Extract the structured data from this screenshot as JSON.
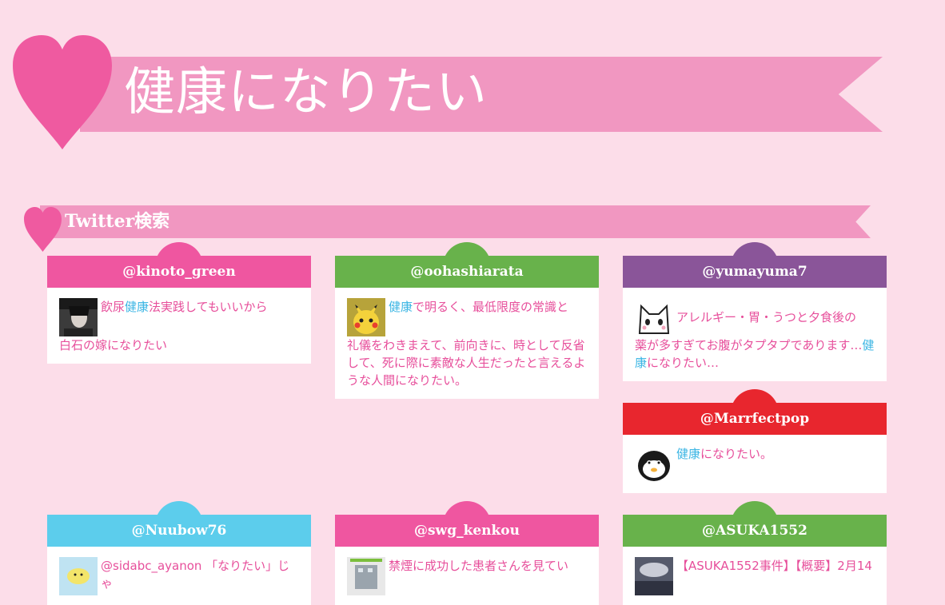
{
  "page": {
    "title": "健康になりたい"
  },
  "section": {
    "title": "Twitter検索"
  },
  "colors": {
    "background": "#fcdde9",
    "banner": "#f197c1",
    "heart": "#ef5aa0",
    "pink": "#ef56a0",
    "green": "#68b24b",
    "purple": "#8a5599",
    "red": "#e8262e",
    "blue": "#5ccdec",
    "highlight": "#3db6e4",
    "text": "#e74f9b"
  },
  "tweets": [
    {
      "user": "@kinoto_green",
      "color": "pink",
      "avatar": "dark-portrait",
      "pre": "飲尿",
      "hl": "健康",
      "post": "法実践してもいいから",
      "cont": "白石の嫁になりたい"
    },
    {
      "user": "@oohashiarata",
      "color": "green",
      "avatar": "pikachu",
      "pre": "",
      "hl": "健康",
      "post": "で明るく、最低限度の常識と",
      "cont": "礼儀をわきまえて、前向きに、時として反省して、死に際に素敵な人生だったと言えるような人間になりたい。"
    },
    {
      "user": "@yumayuma7",
      "color": "purple",
      "avatar": "cat-face",
      "pre": "アレルギー・胃・うつと夕食後の",
      "hl": "",
      "post": "",
      "cont_pre": "薬が多すぎてお腹がタプタプであります…",
      "cont_hl": "健康",
      "cont_post": "になりたい…"
    },
    {
      "user": "@Marrfectpop",
      "color": "red",
      "avatar": "penguin",
      "pre": "",
      "hl": "健康",
      "post": "になりたい。"
    },
    {
      "user": "@Nuubow76",
      "color": "blue",
      "avatar": "yellow-bird",
      "pre": "@sidabc_ayanon 「なりたい」じゃ"
    },
    {
      "user": "@swg_kenkou",
      "color": "pink",
      "avatar": "building",
      "pre": "禁煙に成功した患者さんを見てい"
    },
    {
      "user": "@ASUKA1552",
      "color": "green",
      "avatar": "photo",
      "pre": "【ASUKA1552事件】【概要】2月14"
    }
  ]
}
